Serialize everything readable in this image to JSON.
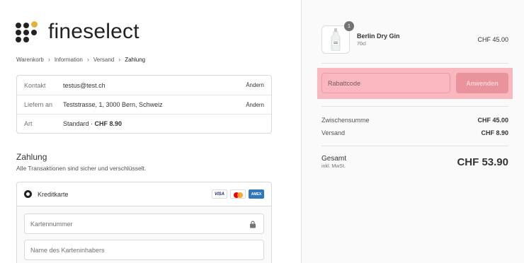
{
  "brand": {
    "name": "fineselect",
    "accent": "#e3b23c"
  },
  "breadcrumb": [
    "Warenkorb",
    "Information",
    "Versand",
    "Zahlung"
  ],
  "review": {
    "rows": [
      {
        "label": "Kontakt",
        "value": "testus@test.ch",
        "link": "Ändern"
      },
      {
        "label": "Liefern an",
        "value": "Teststrasse, 1, 3000 Bern, Schweiz",
        "link": "Ändern"
      },
      {
        "label": "Art",
        "value": "Standard · ",
        "value_bold": "CHF 8.90"
      }
    ]
  },
  "payment": {
    "title": "Zahlung",
    "subtitle": "Alle Transaktionen sind sicher und verschlüsselt.",
    "method": "Kreditkarte",
    "cards": {
      "visa": "VISA",
      "amex": "AMEX"
    },
    "card_number_placeholder": "Kartennummer",
    "cardholder_placeholder": "Name des Karteninhabers"
  },
  "summary": {
    "product": {
      "name": "Berlin Dry Gin",
      "variant": "70cl",
      "price": "CHF 45.00",
      "quantity": "1"
    },
    "discount": {
      "placeholder": "Rabattcode",
      "button": "Anwenden",
      "highlight": "#f9b8bf"
    },
    "subtotal_label": "Zwischensumme",
    "subtotal_value": "CHF 45.00",
    "shipping_label": "Versand",
    "shipping_value": "CHF 8.90",
    "total_label": "Gesamt",
    "total_sub": "inkl. MwSt.",
    "total_value": "CHF 53.90"
  }
}
